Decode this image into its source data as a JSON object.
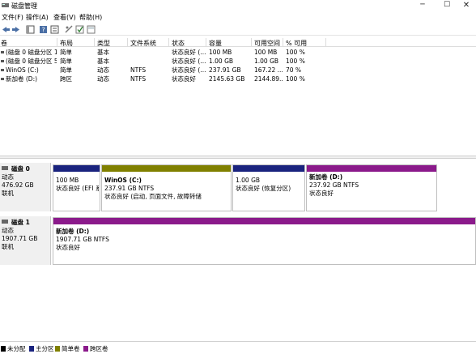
{
  "app": {
    "title": "磁盘管理"
  },
  "window_buttons": {
    "minimize": "─",
    "maximize": "☐",
    "close": "✕"
  },
  "menu": [
    "文件(F)",
    "操作(A)",
    "查看(V)",
    "帮助(H)"
  ],
  "columns": [
    "卷",
    "布局",
    "类型",
    "文件系统",
    "状态",
    "容量",
    "可用空间",
    "% 可用"
  ],
  "volumes": [
    {
      "name": "(磁盘 0 磁盘分区 1)",
      "layout": "简单",
      "type": "基本",
      "fs": "",
      "status": "状态良好 (...",
      "capacity": "100 MB",
      "free": "100 MB",
      "pct": "100 %"
    },
    {
      "name": "(磁盘 0 磁盘分区 5)",
      "layout": "简单",
      "type": "基本",
      "fs": "",
      "status": "状态良好 (...",
      "capacity": "1.00 GB",
      "free": "1.00 GB",
      "pct": "100 %"
    },
    {
      "name": "WinOS (C:)",
      "layout": "简单",
      "type": "动态",
      "fs": "NTFS",
      "status": "状态良好 (...",
      "capacity": "237.91 GB",
      "free": "167.22 ...",
      "pct": "70 %"
    },
    {
      "name": "新加卷 (D:)",
      "layout": "跨区",
      "type": "动态",
      "fs": "NTFS",
      "status": "状态良好",
      "capacity": "2145.63 GB",
      "free": "2144.89...",
      "pct": "100 %"
    }
  ],
  "disks": [
    {
      "name": "磁盘 0",
      "type": "动态",
      "size": "476.92 GB",
      "state": "联机",
      "partitions": [
        {
          "name": "",
          "line1": "100 MB",
          "line2": "状态良好 (EFI 系",
          "color": "#1a237e"
        },
        {
          "name": "WinOS  (C:)",
          "line1": "237.91 GB NTFS",
          "line2": "状态良好 (启动, 页面文件, 故障转储",
          "color": "#808000"
        },
        {
          "name": "",
          "line1": "1.00 GB",
          "line2": "状态良好 (恢复分区)",
          "color": "#1a237e"
        },
        {
          "name": "新加卷  (D:)",
          "line1": "237.92 GB NTFS",
          "line2": "状态良好",
          "color": "#8b1a8b"
        }
      ]
    },
    {
      "name": "磁盘 1",
      "type": "动态",
      "size": "1907.71 GB",
      "state": "联机",
      "partitions": [
        {
          "name": "新加卷  (D:)",
          "line1": "1907.71 GB NTFS",
          "line2": "状态良好",
          "color": "#8b1a8b"
        }
      ]
    }
  ],
  "legend": [
    {
      "label": "未分配",
      "color": "#000000"
    },
    {
      "label": "主分区",
      "color": "#1a237e"
    },
    {
      "label": "简单卷",
      "color": "#808000"
    },
    {
      "label": "跨区卷",
      "color": "#8b1a8b"
    }
  ]
}
